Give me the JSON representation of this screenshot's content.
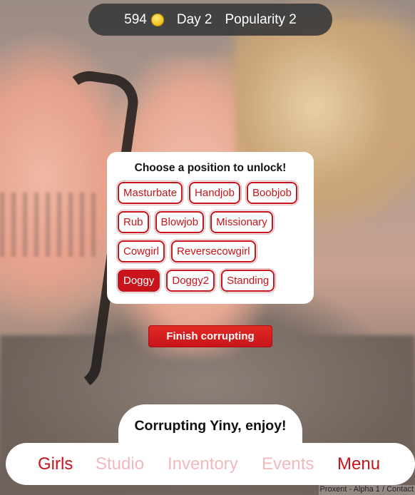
{
  "hud": {
    "money": "594",
    "coin_icon": "coin-icon",
    "day": "Day 2",
    "popularity": "Popularity 2"
  },
  "unlock_panel": {
    "title": "Choose a position to unlock!",
    "positions": [
      {
        "label": "Masturbate",
        "selected": false
      },
      {
        "label": "Handjob",
        "selected": false
      },
      {
        "label": "Boobjob",
        "selected": false
      },
      {
        "label": "Rub",
        "selected": false
      },
      {
        "label": "Blowjob",
        "selected": false
      },
      {
        "label": "Missionary",
        "selected": false
      },
      {
        "label": "Cowgirl",
        "selected": false
      },
      {
        "label": "Reversecowgirl",
        "selected": false
      },
      {
        "label": "Doggy",
        "selected": true
      },
      {
        "label": "Doggy2",
        "selected": false
      },
      {
        "label": "Standing",
        "selected": false
      }
    ]
  },
  "finish_button": "Finish corrupting",
  "message": "Corrupting Yiny, enjoy!",
  "nav": {
    "items": [
      {
        "label": "Girls",
        "enabled": true
      },
      {
        "label": "Studio",
        "enabled": false
      },
      {
        "label": "Inventory",
        "enabled": false
      },
      {
        "label": "Events",
        "enabled": false
      },
      {
        "label": "Menu",
        "enabled": true
      }
    ]
  },
  "footer": "Proxent - Alpha 1 / Contact",
  "colors": {
    "accent": "#c8141a",
    "disabled_nav": "#f2b9bd",
    "hud_bg": "#3c3c3c"
  }
}
